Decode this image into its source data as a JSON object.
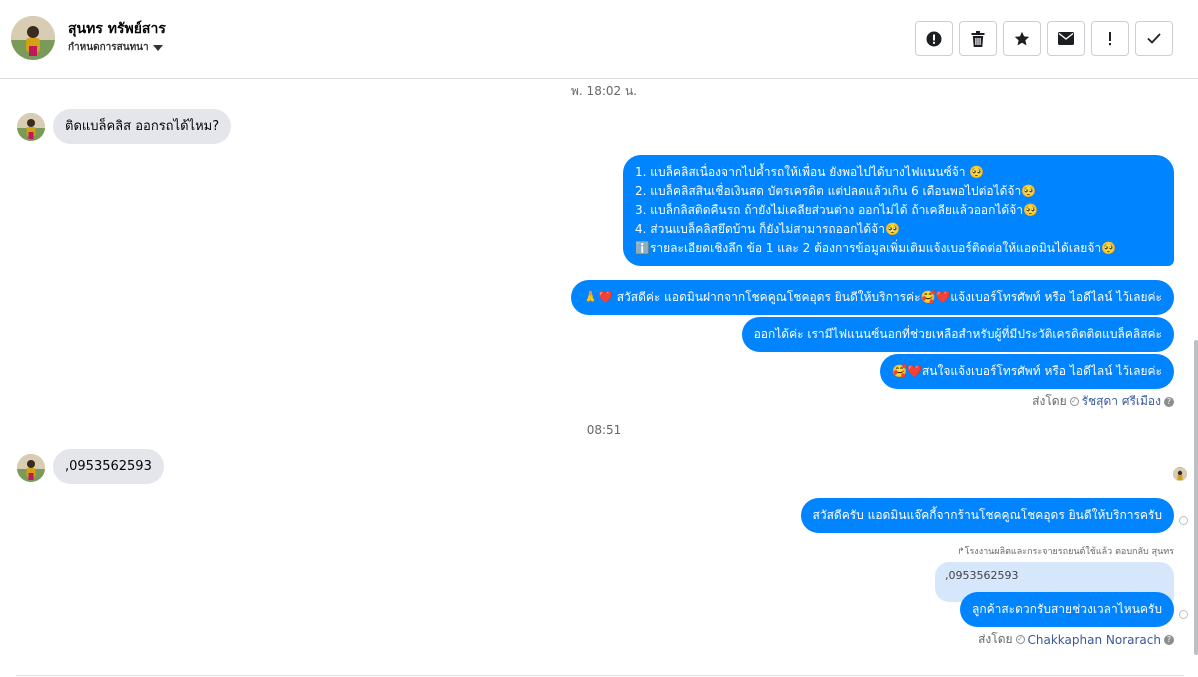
{
  "header": {
    "contact_name": "สุนทร ทรัพย์สาร",
    "label_select": "กำหนดการสนทนา",
    "toolbar": [
      {
        "name": "spam-button",
        "icon": "alert-circle-icon"
      },
      {
        "name": "delete-button",
        "icon": "trash-icon"
      },
      {
        "name": "star-button",
        "icon": "star-icon"
      },
      {
        "name": "mark-unread-button",
        "icon": "envelope-icon"
      },
      {
        "name": "follow-up-button",
        "icon": "exclamation-icon"
      },
      {
        "name": "mark-done-button",
        "icon": "checkmark-icon"
      }
    ]
  },
  "conversation": {
    "timestamp_1": "พ. 18:02 น.",
    "incoming_1": "ติดแบล็คลิส ออกรถได้ไหม?",
    "outgoing_multi": [
      "1. แบล็คลิสเนื่องจากไปค้ำรถให้เพื่อน ยังพอไปได้บางไฟแนนซ์จ้า 🥺",
      "2. แบล็คลิสสินเชื่อเงินสด บัตรเครดิต แต่ปลดแล้วเกิน 6 เดือนพอไปต่อได้จ้า🥺",
      "3. แบล็กลิสติดคืนรถ ถ้ายังไม่เคลียส่วนต่าง ออกไม่ได้ ถ้าเคลียแล้วออกได้จ้า🥺",
      "4. ส่วนแบล็คลิสยึดบ้าน ก็ยังไม่สามารถออกได้จ้า🥺",
      "ℹ️รายละเอียดเชิงลึก ข้อ 1 และ 2 ต้องการข้อมูลเพิ่มเติมแจ้งเบอร์ติดต่อให้แอดมินได้เลยจ้า🥺"
    ],
    "outgoing_2": "🙏❤️ สวัสดีค่ะ แอดมินฝากจากโชคคูณโชคอุดร ยินดีให้บริการค่ะ🥰❤️แจ้งเบอร์โทรศัพท์ หรือ ไอดีไลน์  ไว้เลยค่ะ",
    "outgoing_3": "ออกได้ค่ะ เรามีไฟแนนซ์นอกที่ช่วยเหลือสำหรับผู้ที่มีประวัติเครดิตติดแบล็คลิสค่ะ",
    "outgoing_4": "🥰❤️สนใจแจ้งเบอร์โทรศัพท์ หรือ ไอดีไลน์  ไว้เลยค่ะ",
    "sent_by_prefix_1": "ส่งโดย",
    "sent_by_agent_1": "รัชสุดา ศรีเมือง",
    "timestamp_2": "08:51",
    "incoming_2": ",0953562593",
    "outgoing_5": "สวัสดีครับ แอดมินแจ๊คกี้จากร้านโชคคูณโชคอุดร ยินดีให้บริการครับ",
    "reply_note": "↱โรงงานผลิตและกระจายรถยนต์ใช้แล้ว ตอบกลับ สุนทร",
    "quoted_text": ",0953562593",
    "outgoing_6": "ลูกค้าสะดวกรับสายช่วงเวลาไหนครับ",
    "sent_by_prefix_2": "ส่งโดย",
    "sent_by_agent_2": "Chakkaphan Norarach"
  },
  "colors": {
    "outgoing_bubble": "#0084ff",
    "incoming_bubble": "#e4e6eb",
    "quoted_bubble": "#d6e6fb",
    "agent_link": "#385898"
  }
}
